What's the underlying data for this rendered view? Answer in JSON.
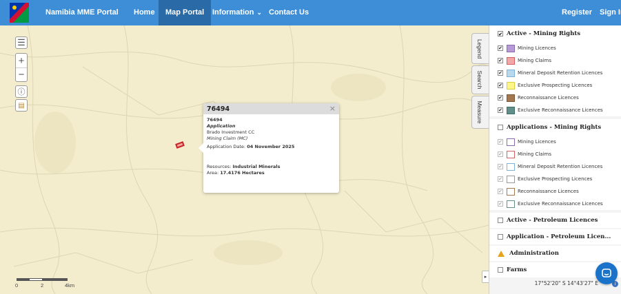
{
  "navbar": {
    "brand": "Namibia MME Portal",
    "items": [
      {
        "label": "Home"
      },
      {
        "label": "Map Portal",
        "active": true
      },
      {
        "label": "Information",
        "has_dropdown": true
      },
      {
        "label": "Contact Us"
      }
    ],
    "register": "Register",
    "sign_in": "Sign In"
  },
  "side_tabs": [
    "Legend",
    "Search",
    "Measure"
  ],
  "popup": {
    "title": "76494",
    "id": "76494",
    "status": "Application",
    "holder": "Brado Investment CC",
    "type": "Mining Claim (MC)",
    "date_label": "Application Date:",
    "date_value": "04 November 2025",
    "resources_label": "Resources:",
    "resources_value": "Industrial Minerals",
    "area_label": "Area:",
    "area_value": "17.4176 Hectares"
  },
  "scale": {
    "labels": [
      "0",
      "2",
      "4km"
    ]
  },
  "layers": {
    "active_mining": {
      "title": "Active - Mining Rights",
      "checked": true,
      "items": [
        {
          "label": "Mining Licences",
          "color": "#b79bd6",
          "border": "#8a6aae"
        },
        {
          "label": "Mining Claims",
          "color": "#f2a6a6",
          "border": "#d45f5f"
        },
        {
          "label": "Mineral Deposit Retention Licences",
          "color": "#b8d8ee",
          "border": "#7fb1d6"
        },
        {
          "label": "Exclusive Prospecting Licences",
          "color": "#fbf58a",
          "border": "#d8cf3c"
        },
        {
          "label": "Reconnaissance Licences",
          "color": "#a3774f",
          "border": "#7d5532"
        },
        {
          "label": "Exclusive Reconnaissance Licences",
          "color": "#5f8f88",
          "border": "#3f6e67"
        }
      ]
    },
    "applications_mining": {
      "title": "Applications - Mining Rights",
      "checked": false,
      "items": [
        {
          "label": "Mining Licences",
          "border": "#8a6aae"
        },
        {
          "label": "Mining Claims",
          "border": "#d45f5f"
        },
        {
          "label": "Mineral Deposit Retention Licences",
          "border": "#7fb1d6"
        },
        {
          "label": "Exclusive Prospecting Licences",
          "border": "#999999"
        },
        {
          "label": "Reconnaissance Licences",
          "border": "#a3774f"
        },
        {
          "label": "Exclusive Reconnaissance Licences",
          "border": "#5f8f88"
        }
      ]
    },
    "active_petroleum": {
      "title": "Active - Petroleum Licences"
    },
    "application_petroleum": {
      "title": "Application - Petroleum Licen..."
    },
    "administration": {
      "title": "Administration"
    },
    "farms": {
      "title": "Farms"
    }
  },
  "coords": {
    "text": "17°52'20\" S  14°43'27\" E"
  },
  "colors": {
    "navbar": "#3d8ed7",
    "navbar_active": "#2a6aa6",
    "map_bg": "#f3edcd",
    "chat": "#1b72c9"
  }
}
